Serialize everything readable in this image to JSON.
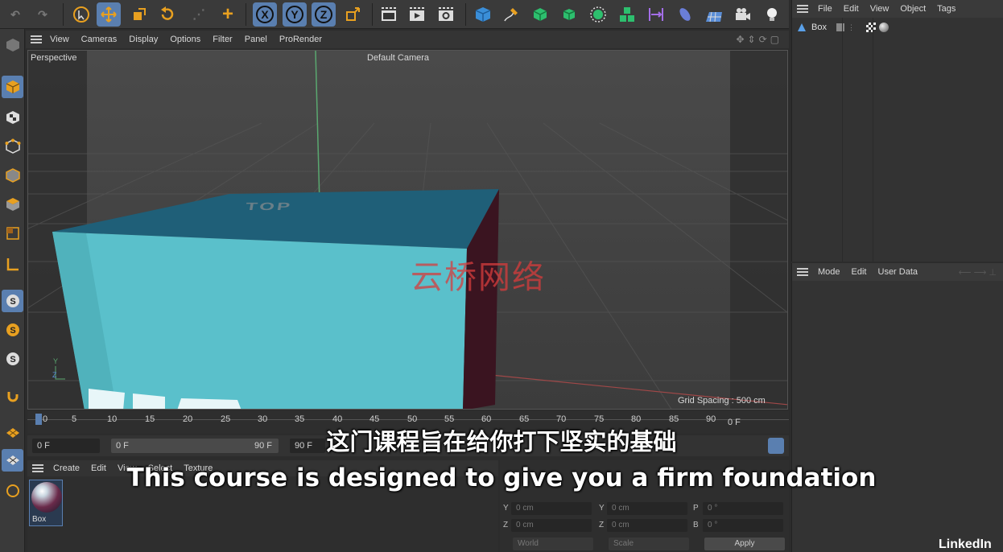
{
  "viewport": {
    "menu": [
      "View",
      "Cameras",
      "Display",
      "Options",
      "Filter",
      "Panel",
      "ProRender"
    ],
    "name": "Perspective",
    "camera": "Default Camera",
    "grid_spacing": "Grid Spacing : 500 cm",
    "cube_top_label": "TOP",
    "axis_y": "Y",
    "axis_z": "Z"
  },
  "toolbar": {
    "axis_x": "X",
    "axis_y": "Y",
    "axis_z": "Z",
    "accent": "#5a7fb0"
  },
  "object_manager": {
    "menu": [
      "File",
      "Edit",
      "View",
      "Object",
      "Tags"
    ],
    "object_name": "Box"
  },
  "attribute_manager": {
    "menu": [
      "Mode",
      "Edit",
      "User Data"
    ]
  },
  "timeline": {
    "ticks": [
      "0",
      "5",
      "10",
      "15",
      "20",
      "25",
      "30",
      "35",
      "40",
      "45",
      "50",
      "55",
      "60",
      "65",
      "70",
      "75",
      "80",
      "85",
      "90"
    ],
    "end_label": "0 F",
    "current_frame": "0 F",
    "min_frame": "0 F",
    "max_frame": "90 F",
    "end_frame": "90 F"
  },
  "material_manager": {
    "menu": [
      "Create",
      "Edit",
      "View",
      "Select",
      "Texture"
    ],
    "material_name": "Box"
  },
  "coordinates": {
    "y_label": "Y",
    "y_pos": "0 cm",
    "y_size_label": "Y",
    "y_size": "0 cm",
    "p_label": "P",
    "p_rot": "0 °",
    "z_label": "Z",
    "z_pos": "0 cm",
    "z_size_label": "Z",
    "z_size": "0 cm",
    "b_label": "B",
    "b_rot": "0 °",
    "space": "World",
    "mode": "Scale",
    "apply": "Apply"
  },
  "overlay": {
    "subtitle_zh": "这门课程旨在给你打下坚实的基础",
    "subtitle_en": "This course is designed to give you a firm foundation",
    "watermark": "云桥网络",
    "brand": "LinkedIn"
  }
}
